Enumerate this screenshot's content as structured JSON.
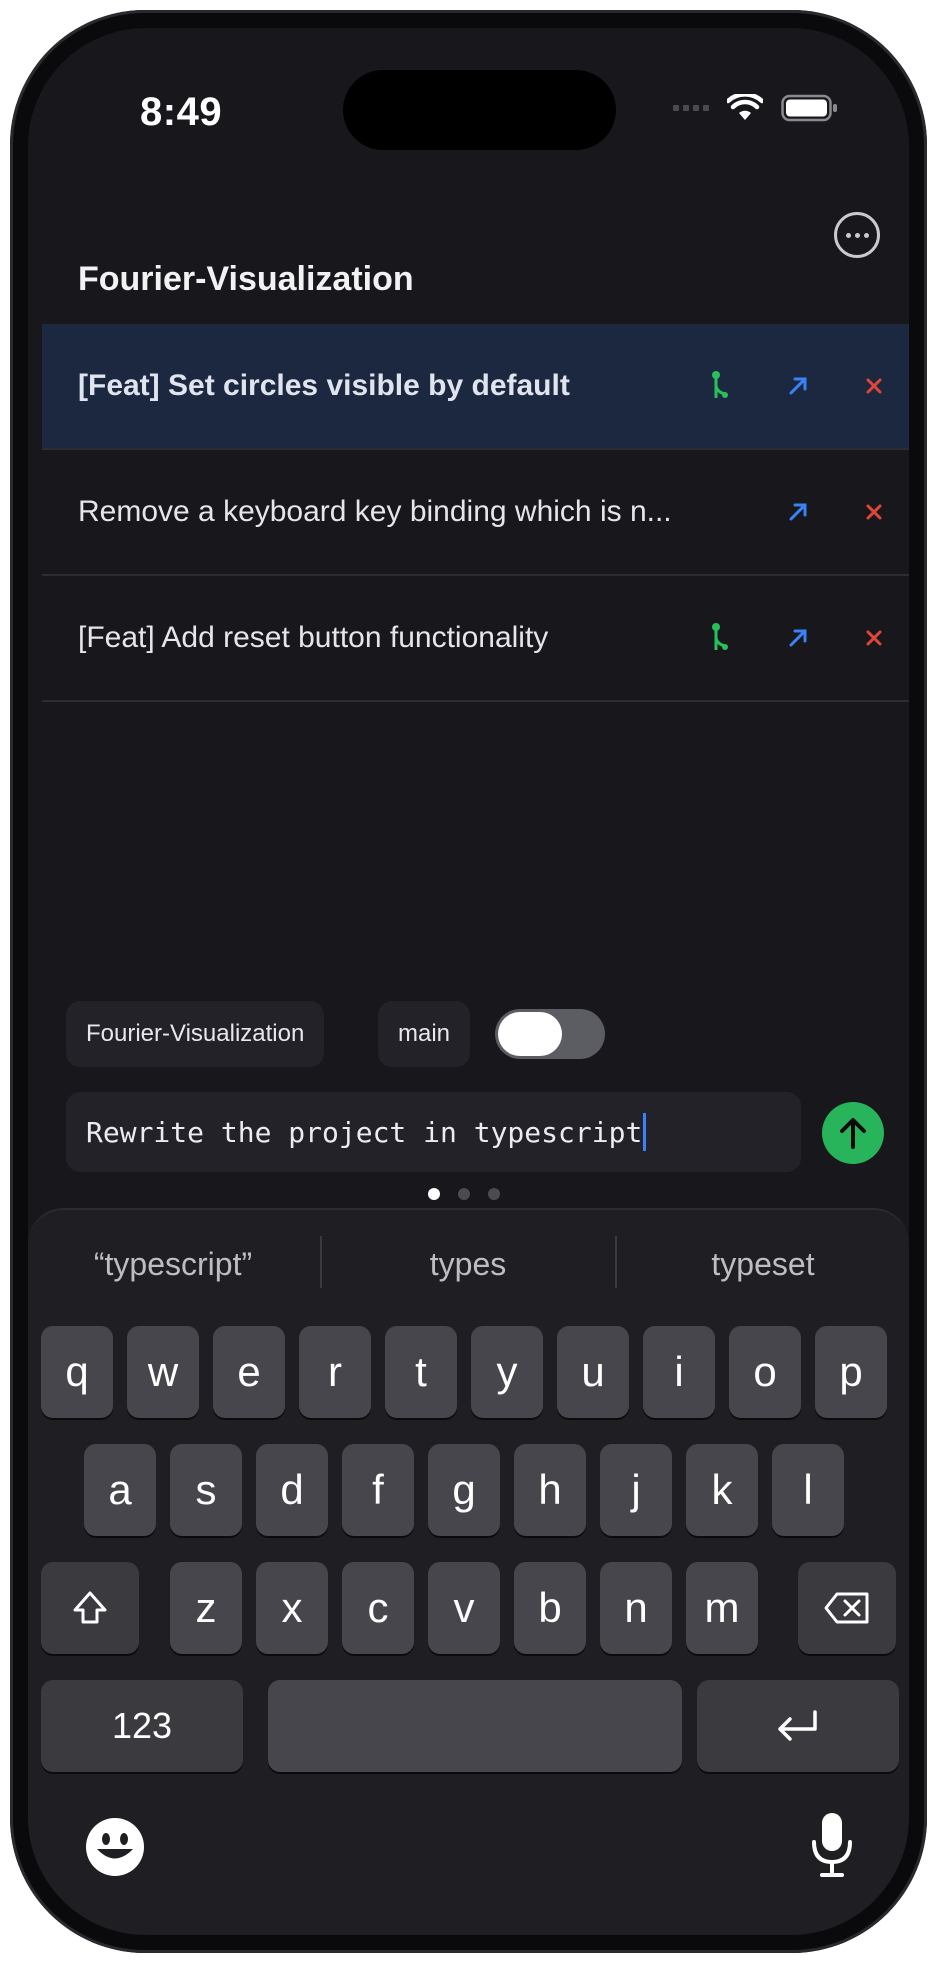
{
  "status_bar": {
    "time": "8:49"
  },
  "header": {
    "title": "Fourier-Visualization",
    "more_icon": "ellipsis-circle-icon"
  },
  "tasks": [
    {
      "label": "[Feat] Set circles visible by default",
      "selected": true,
      "has_merge": true
    },
    {
      "label": "Remove a keyboard key binding which is n...",
      "selected": false,
      "has_merge": false
    },
    {
      "label": "[Feat] Add reset button functionality",
      "selected": false,
      "has_merge": true
    }
  ],
  "chips": {
    "repo": "Fourier-Visualization",
    "branch": "main",
    "toggle_on": false
  },
  "prompt": {
    "value": "Rewrite the project in typescript"
  },
  "page_dots": {
    "count": 3,
    "active": 0
  },
  "keyboard": {
    "suggestions": [
      "“typescript”",
      "types",
      "typeset"
    ],
    "row1": [
      "q",
      "w",
      "e",
      "r",
      "t",
      "y",
      "u",
      "i",
      "o",
      "p"
    ],
    "row2": [
      "a",
      "s",
      "d",
      "f",
      "g",
      "h",
      "j",
      "k",
      "l"
    ],
    "row3": [
      "z",
      "x",
      "c",
      "v",
      "b",
      "n",
      "m"
    ],
    "numbers_key": "123"
  },
  "colors": {
    "accent_green": "#28b45a",
    "accent_blue": "#3b82f6",
    "close_red": "#e0453a",
    "selected_row": "#1c2840"
  }
}
